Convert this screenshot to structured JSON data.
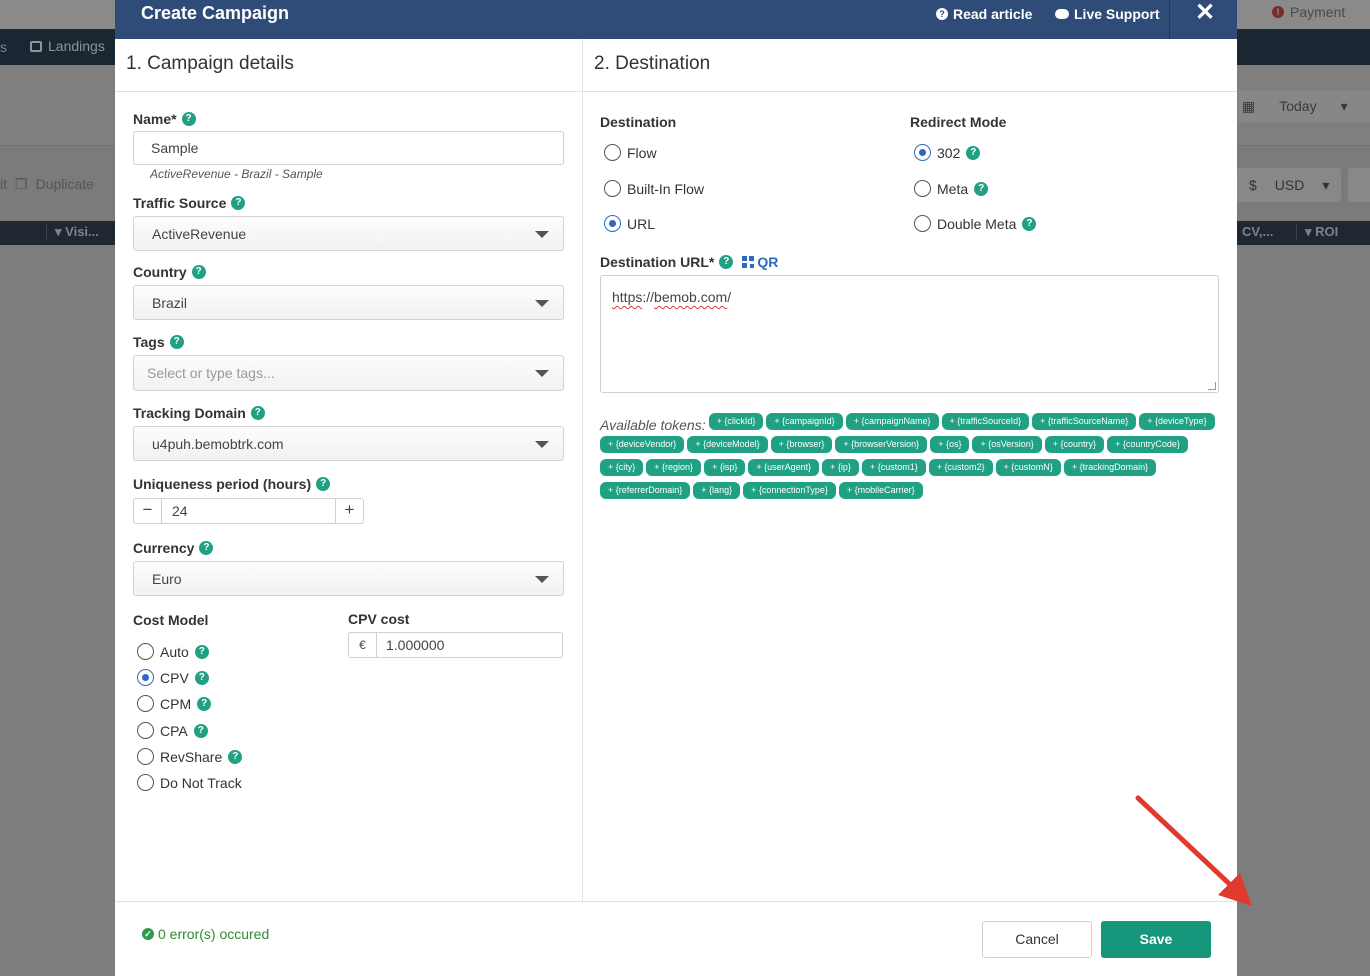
{
  "background": {
    "payment": "Payment",
    "nav_partial": "s",
    "landings": "Landings",
    "duplicate": "Duplicate",
    "duplicate_prefix": "it",
    "date_range": "Today",
    "currency_symbol": "$",
    "currency": "USD",
    "col_visits": "Visi...",
    "col_cv": "CV,...",
    "col_roi": "ROI"
  },
  "modal": {
    "title": "Create Campaign",
    "read_article": "Read article",
    "live_support": "Live Support",
    "close": "✕"
  },
  "details": {
    "heading": "1. Campaign details",
    "name_label": "Name*",
    "name_value": "Sample",
    "name_hint": "ActiveRevenue - Brazil - Sample",
    "traffic_source_label": "Traffic Source",
    "traffic_source_value": "ActiveRevenue",
    "country_label": "Country",
    "country_value": "Brazil",
    "tags_label": "Tags",
    "tags_placeholder": "Select or type tags...",
    "tracking_domain_label": "Tracking Domain",
    "tracking_domain_value": "u4puh.bemobtrk.com",
    "uniqueness_label": "Uniqueness period (hours)",
    "uniqueness_value": "24",
    "currency_label": "Currency",
    "currency_value": "Euro",
    "cost_model_label": "Cost Model",
    "cost_models": [
      {
        "label": "Auto",
        "checked": false,
        "help": true
      },
      {
        "label": "CPV",
        "checked": true,
        "help": true
      },
      {
        "label": "CPM",
        "checked": false,
        "help": true
      },
      {
        "label": "CPA",
        "checked": false,
        "help": true
      },
      {
        "label": "RevShare",
        "checked": false,
        "help": true
      },
      {
        "label": "Do Not Track",
        "checked": false,
        "help": false
      }
    ],
    "cpv_cost_label": "CPV cost",
    "cpv_currency_symbol": "€",
    "cpv_cost_value": "1.000000"
  },
  "destination": {
    "heading": "2. Destination",
    "destination_label": "Destination",
    "destination_options": [
      {
        "label": "Flow",
        "checked": false
      },
      {
        "label": "Built-In Flow",
        "checked": false
      },
      {
        "label": "URL",
        "checked": true
      }
    ],
    "redirect_label": "Redirect Mode",
    "redirect_options": [
      {
        "label": "302",
        "checked": true
      },
      {
        "label": "Meta",
        "checked": false
      },
      {
        "label": "Double Meta",
        "checked": false
      }
    ],
    "url_label": "Destination URL*",
    "qr_label": "QR",
    "url_value_part1": "https",
    "url_value_sep": "://",
    "url_value_part2": "bemob.com",
    "url_value_end": "/",
    "tokens_label": "Available tokens:",
    "tokens": [
      "+ {clickId}",
      "+ {campaignId}",
      "+ {campaignName}",
      "+ {trafficSourceId}",
      "+ {trafficSourceName}",
      "+ {deviceType}",
      "+ {deviceVendor}",
      "+ {deviceModel}",
      "+ {browser}",
      "+ {browserVersion}",
      "+ {os}",
      "+ {osVersion}",
      "+ {country}",
      "+ {countryCode}",
      "+ {city}",
      "+ {region}",
      "+ {isp}",
      "+ {userAgent}",
      "+ {ip}",
      "+ {custom1}",
      "+ {custom2}",
      "+ {customN}",
      "+ {trackingDomain}",
      "+ {referrerDomain}",
      "+ {lang}",
      "+ {connectionType}",
      "+ {mobileCarrier}"
    ]
  },
  "footer": {
    "errors": "0 error(s) occured",
    "cancel": "Cancel",
    "save": "Save"
  },
  "colors": {
    "header": "#2f4b78",
    "accent_green": "#21a184",
    "save_button": "#16977b",
    "radio_blue": "#2b6ac4",
    "annotation_arrow": "#e03a2f"
  }
}
